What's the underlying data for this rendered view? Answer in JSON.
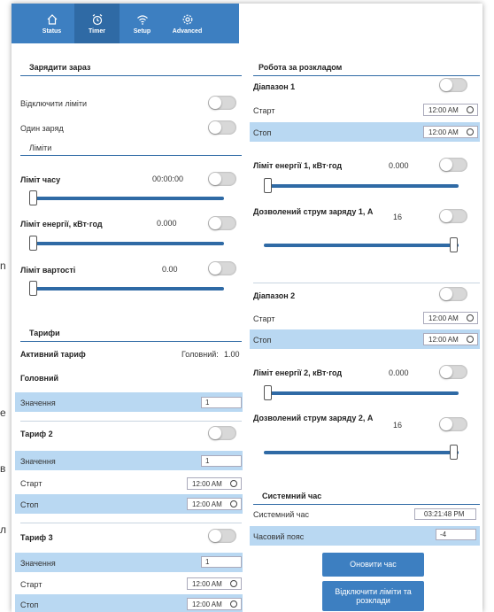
{
  "background_chars": [
    "n",
    "e",
    "в",
    "л"
  ],
  "nav": {
    "items": [
      {
        "label": "Status",
        "icon": "home-icon"
      },
      {
        "label": "Timer",
        "icon": "alarm-clock-icon"
      },
      {
        "label": "Setup",
        "icon": "wifi-icon"
      },
      {
        "label": "Advanced",
        "icon": "gear-icon"
      }
    ],
    "active": "Timer"
  },
  "left": {
    "charge_now": {
      "title": "Зарядити зараз",
      "disable_limits": "Відключити ліміти",
      "one_charge": "Один заряд",
      "limits_title": "Ліміти",
      "time_limit": {
        "label": "Ліміт часу",
        "value": "00:00:00",
        "slider_fraction": 0
      },
      "energy_limit": {
        "label": "Ліміт енергії, кВт·год",
        "value": "0.000",
        "slider_fraction": 0
      },
      "cost_limit": {
        "label": "Ліміт вартості",
        "value": "0.00",
        "slider_fraction": 0
      }
    },
    "tariffs": {
      "title": "Тарифи",
      "active_label": "Активний тариф",
      "active_name": "Головний:",
      "active_value": "1.00",
      "main": {
        "title": "Головний",
        "value_label": "Значення",
        "value": "1"
      },
      "tariff2": {
        "title": "Тариф 2",
        "value_label": "Значення",
        "value": "1",
        "start_label": "Старт",
        "start": "12:00 AM",
        "stop_label": "Стоп",
        "stop": "12:00 AM"
      },
      "tariff3": {
        "title": "Тариф 3",
        "value_label": "Значення",
        "value": "1",
        "start_label": "Старт",
        "start": "12:00 AM",
        "stop_label": "Стоп",
        "stop": "12:00 AM"
      }
    }
  },
  "right": {
    "schedule": {
      "title": "Робота за розкладом",
      "range1": {
        "title": "Діапазон 1",
        "start_label": "Старт",
        "start": "12:00 AM",
        "stop_label": "Стоп",
        "stop": "12:00 AM",
        "energy_label": "Ліміт енергії 1, кВт·год",
        "energy_value": "0.000",
        "energy_fraction": 0,
        "current_label": "Дозволений струм заряду 1, А",
        "current_value": "16",
        "current_fraction": 1
      },
      "range2": {
        "title": "Діапазон 2",
        "start_label": "Старт",
        "start": "12:00 AM",
        "stop_label": "Стоп",
        "stop": "12:00 AM",
        "energy_label": "Ліміт енергії 2, кВт·год",
        "energy_value": "0.000",
        "energy_fraction": 0,
        "current_label": "Дозволений струм заряду 2, А",
        "current_value": "16",
        "current_fraction": 1
      }
    },
    "system_time": {
      "title": "Системний час",
      "time_label": "Системний час",
      "time_value": "03:21:48 PM",
      "tz_label": "Часовий пояс",
      "tz_value": "-4",
      "update_button": "Оновити час",
      "disable_button": "Відключити ліміти та розклади"
    }
  }
}
